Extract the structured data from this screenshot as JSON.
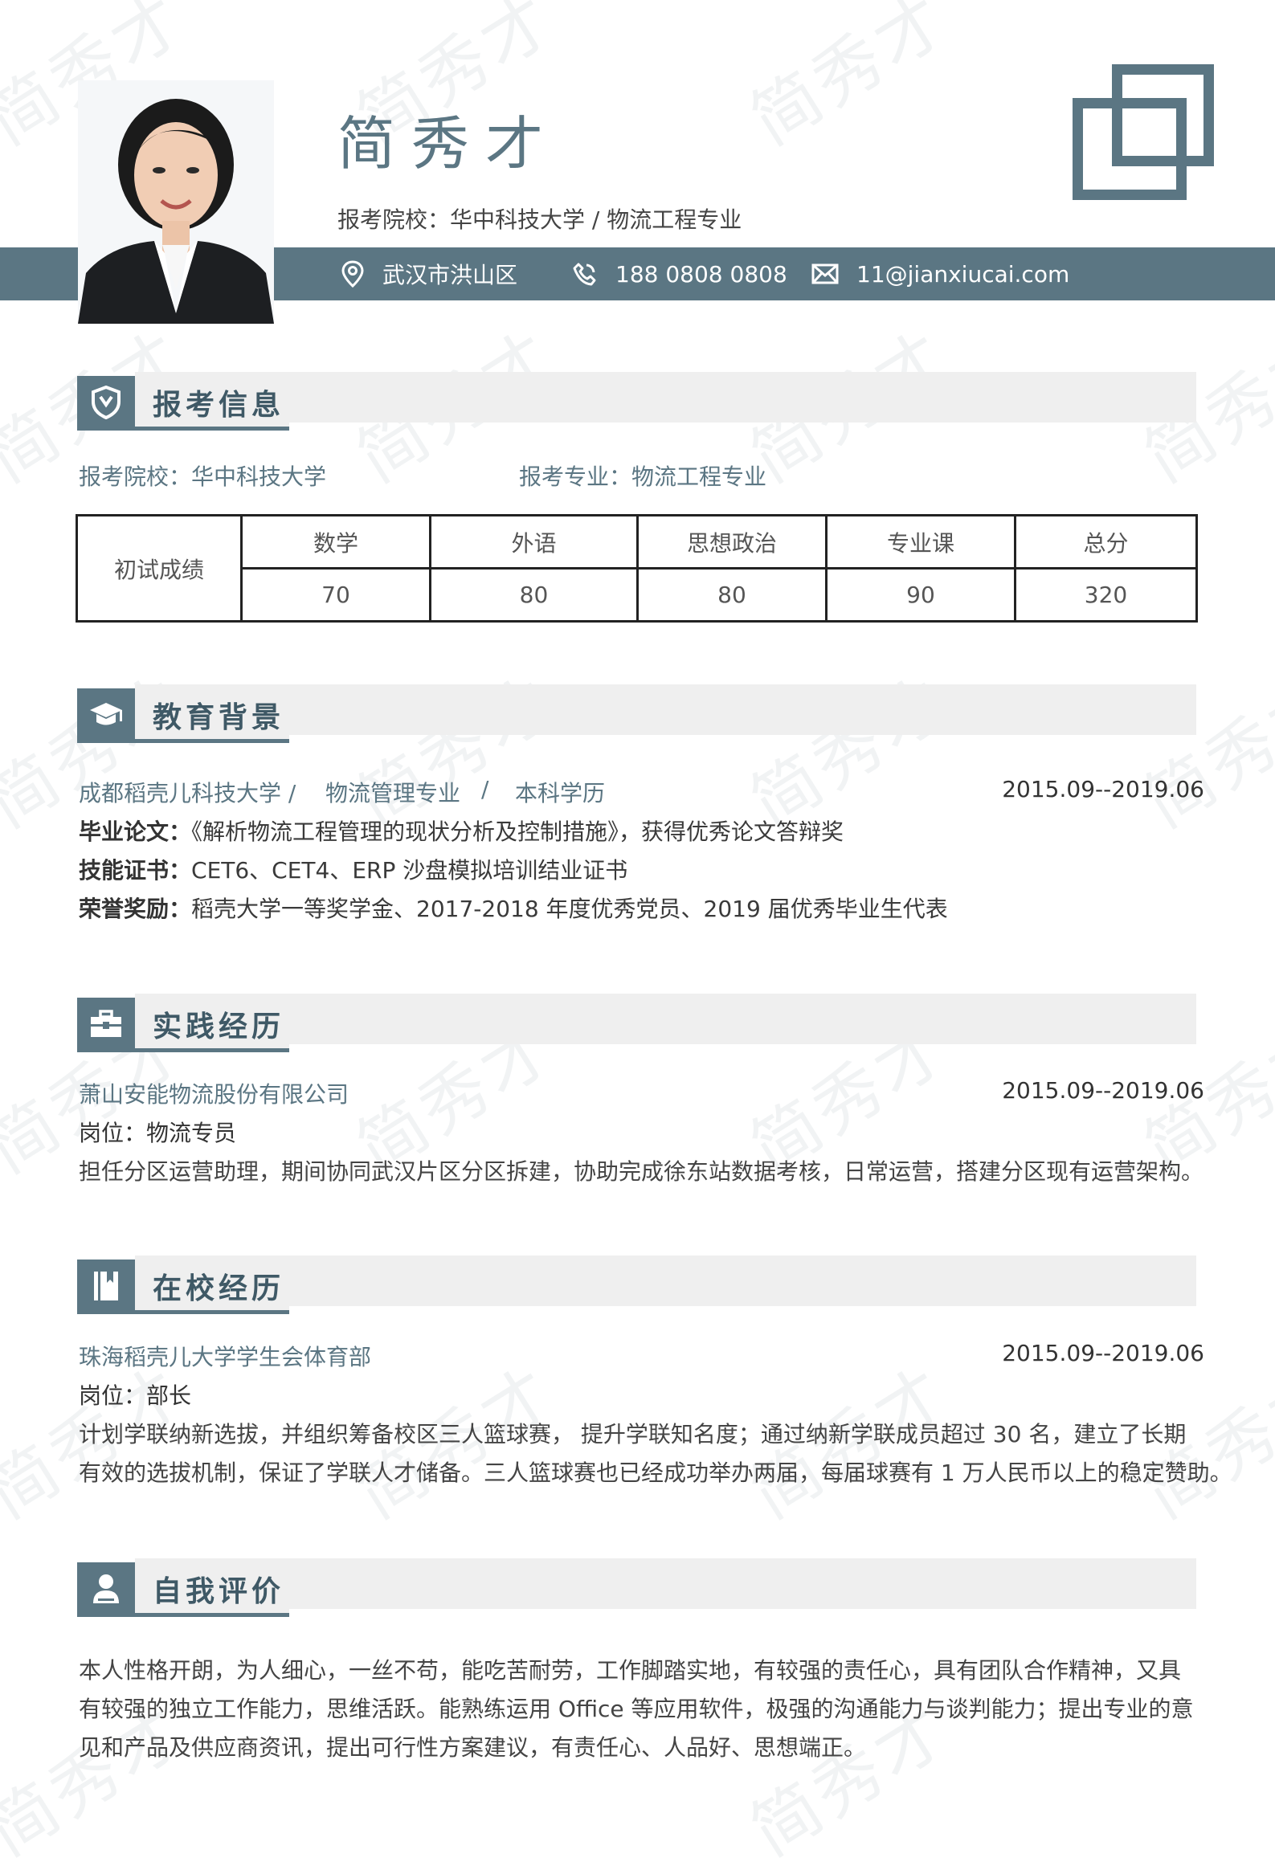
{
  "watermark": "简秀才",
  "header": {
    "name": "简秀才",
    "target_label": "报考院校：华中科技大学 / 物流工程专业",
    "location": "武汉市洪山区",
    "phone": "188 0808 0808",
    "email": "11@jianxiucai.com"
  },
  "sections": {
    "exam_info": "报考信息",
    "education": "教育背景",
    "practice": "实践经历",
    "campus": "在校经历",
    "self_eval": "自我评价"
  },
  "exam": {
    "school": "报考院校：华中科技大学",
    "major": "报考专业：物流工程专业",
    "row_label": "初试成绩",
    "subjects": [
      "数学",
      "外语",
      "思想政治",
      "专业课",
      "总分"
    ],
    "scores": [
      "70",
      "80",
      "80",
      "90",
      "320"
    ]
  },
  "education": {
    "school": "成都稻壳儿科技大学 /",
    "major": "物流管理专业",
    "sep": "/",
    "degree": "本科学历",
    "date": "2015.09--2019.06",
    "thesis_label": "毕业论文：",
    "thesis": "《解析物流工程管理的现状分析及控制措施》，获得优秀论文答辩奖",
    "cert_label": "技能证书：",
    "cert": "CET6、CET4、ERP 沙盘模拟培训结业证书",
    "honor_label": "荣誉奖励：",
    "honor": "稻壳大学一等奖学金、2017-2018 年度优秀党员、2019 届优秀毕业生代表"
  },
  "practice": {
    "company": "萧山安能物流股份有限公司",
    "date": "2015.09--2019.06",
    "position": "岗位：物流专员",
    "desc": "担任分区运营助理，期间协同武汉片区分区拆建，协助完成徐东站数据考核，日常运营，搭建分区现有运营架构。"
  },
  "campus": {
    "org": "珠海稻壳儿大学学生会体育部",
    "date": "2015.09--2019.06",
    "position": "岗位：部长",
    "desc_line1": "计划学联纳新选拔，并组织筹备校区三人篮球赛， 提升学联知名度；通过纳新学联成员超过 30 名，建立了长期",
    "desc_line2": "有效的选拔机制，保证了学联人才储备。三人篮球赛也已经成功举办两届，每届球赛有 1 万人民币以上的稳定赞助。"
  },
  "self_eval": {
    "line1": "本人性格开朗，为人细心，一丝不苟，能吃苦耐劳，工作脚踏实地，有较强的责任心，具有团队合作精神，又具",
    "line2": "有较强的独立工作能力，思维活跃。能熟练运用 Office 等应用软件，极强的沟通能力与谈判能力；提出专业的意",
    "line3": "见和产品及供应商资讯，提出可行性方案建议，有责任心、人品好、思想端正。"
  },
  "colors": {
    "accent": "#5b7683",
    "band": "#5b7683",
    "section_bg": "#efefef"
  },
  "icons": [
    "user-photo",
    "location-icon",
    "phone-icon",
    "mail-icon",
    "shield-icon",
    "graduation-cap-icon",
    "briefcase-icon",
    "book-icon",
    "person-icon"
  ]
}
